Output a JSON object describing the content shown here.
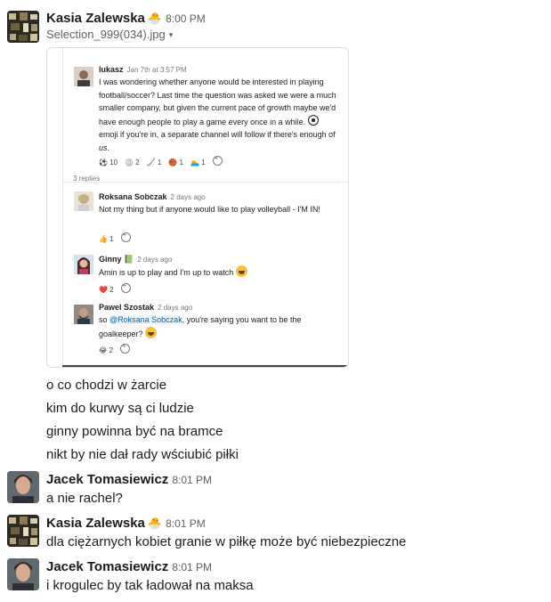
{
  "messages": {
    "m1": {
      "author": "Kasia Zalewska",
      "status_emoji": "🐣",
      "time": "8:00 PM",
      "file_name": "Selection_999(034).jpg",
      "file_caret": "▾"
    },
    "lines": [
      "o co chodzi w żarcie",
      "kim do kurwy są ci ludzie",
      "ginny powinna być na bramce",
      "nikt by nie dał rady wściubić piłki"
    ],
    "m2": {
      "author": "Jacek Tomasiewicz",
      "time": "8:01 PM",
      "text": "a nie rachel?"
    },
    "m3": {
      "author": "Kasia Zalewska",
      "status_emoji": "🐣",
      "time": "8:01 PM",
      "text": "dla ciężarnych kobiet granie w piłkę może być niebezpieczne"
    },
    "m4": {
      "author": "Jacek Tomasiewicz",
      "time": "8:01 PM",
      "text": "i krogulec by tak ładował na maksa"
    }
  },
  "screenshot": {
    "post": {
      "author": "lukasz",
      "time": "Jan 7th at 3:57 PM",
      "text_part1": "I was wondering whether anyone would be interested in playing football/soccer? Last time the question was asked we were a much smaller company, but given the current pace of growth maybe we'd have enough people to play a game every once in a while. ",
      "text_part2": " emoji if you're in, a separate channel will follow if there's enough of ",
      "text_em": "us",
      "text_end": ".",
      "reactions": [
        "⚽ 10",
        "🏐 2",
        "🏑 1",
        "🏀 1",
        "🏊 1"
      ]
    },
    "replies_label": "3 replies",
    "r1": {
      "author": "Roksana Sobczak",
      "time": "2 days ago",
      "text": "Not my thing but if anyone would like to play volleyball - I'M IN!",
      "reaction": "👍 1"
    },
    "r2": {
      "author": "Ginny",
      "status_emoji": "📗",
      "time": "2 days ago",
      "text": "Amin is up to play and I'm up to watch",
      "reaction": "❤️ 2"
    },
    "r3": {
      "author": "Pawel Szostak",
      "time": "2 days ago",
      "text_pre": "so ",
      "mention": "@Roksana Sobczak",
      "text_post": ", you're saying you want to be the goalkeeper? ",
      "reaction": "😂 2"
    }
  },
  "colors": {
    "link": "#1264a3",
    "time": "#616061",
    "text": "#1d1c1d"
  }
}
